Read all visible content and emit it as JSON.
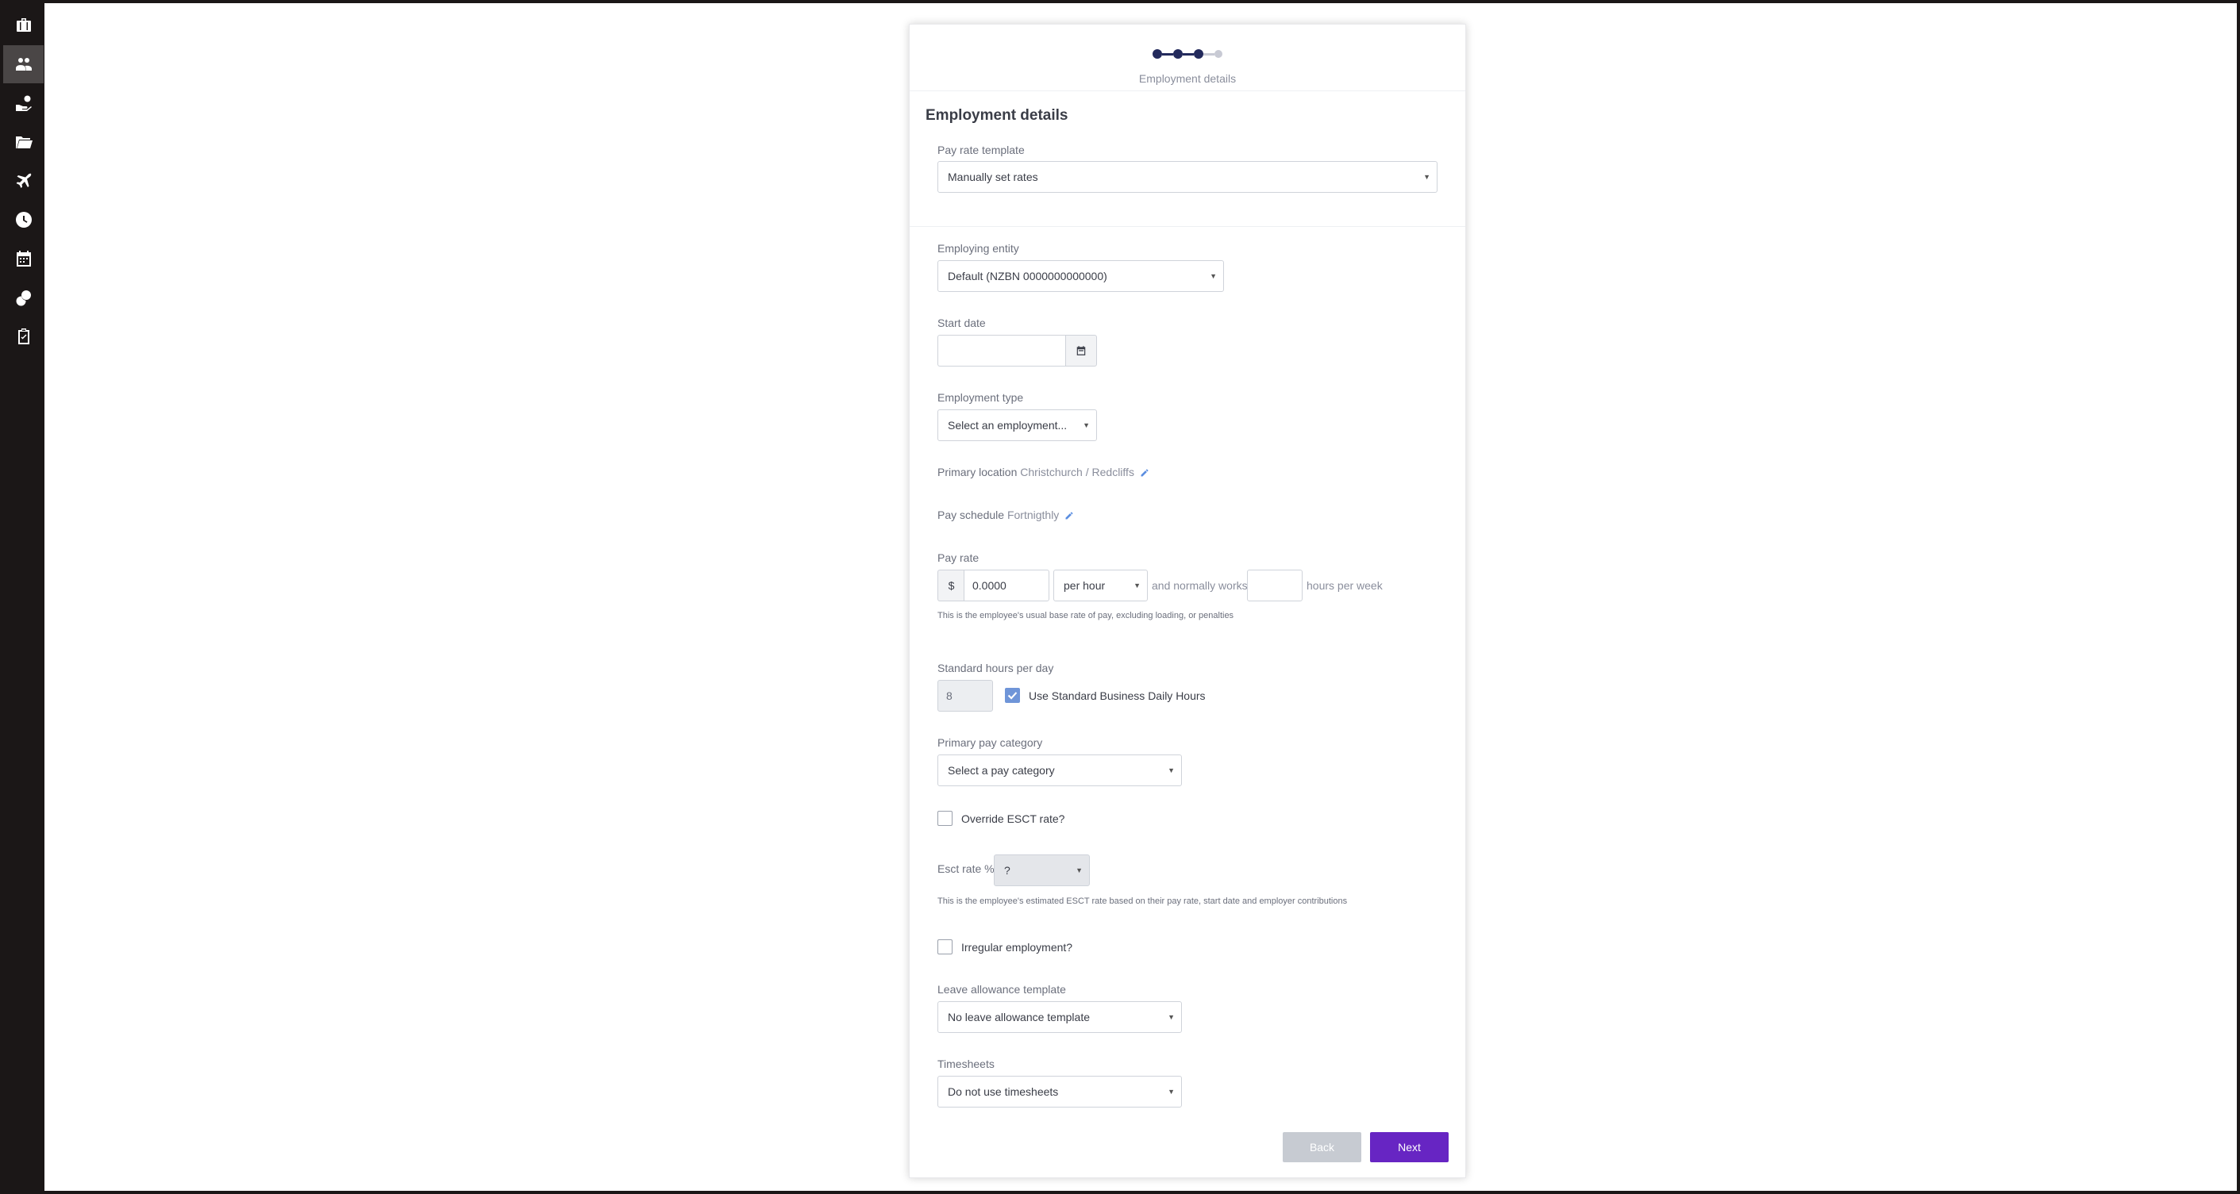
{
  "sidebar": {
    "items": [
      {
        "icon": "briefcase-icon"
      },
      {
        "icon": "people-icon",
        "active": true
      },
      {
        "icon": "hand-coin-icon"
      },
      {
        "icon": "folder-icon"
      },
      {
        "icon": "airplane-icon"
      },
      {
        "icon": "clock-icon"
      },
      {
        "icon": "calendar-icon"
      },
      {
        "icon": "coins-icon"
      },
      {
        "icon": "clipboard-icon"
      }
    ]
  },
  "stepper": {
    "caption": "Employment details",
    "steps_total": 4,
    "steps_completed": 3
  },
  "section_title": "Employment details",
  "pay_rate_template": {
    "label": "Pay rate template",
    "value": "Manually set rates"
  },
  "employing_entity": {
    "label": "Employing entity",
    "value": "Default (NZBN 0000000000000)"
  },
  "start_date": {
    "label": "Start date",
    "value": ""
  },
  "employment_type": {
    "label": "Employment type",
    "value": "Select an employment..."
  },
  "primary_location": {
    "label": "Primary location",
    "value": "Christchurch / Redcliffs"
  },
  "pay_schedule": {
    "label": "Pay schedule",
    "value": "Fortnigthly"
  },
  "pay_rate": {
    "label": "Pay rate",
    "currency": "$",
    "amount": "0.0000",
    "unit": "per hour",
    "mid_text": "and normally works",
    "hours_value": "",
    "end_text": "hours per week",
    "help": "This is the employee's usual base rate of pay, excluding loading, or penalties"
  },
  "standard_hours": {
    "label": "Standard hours per day",
    "value": "8",
    "checkbox_label": "Use Standard Business Daily Hours",
    "checked": true
  },
  "primary_pay_category": {
    "label": "Primary pay category",
    "value": "Select a pay category"
  },
  "override_esct": {
    "label": "Override ESCT rate?",
    "checked": false
  },
  "esct_rate": {
    "label": "Esct rate %",
    "value": "?",
    "help": "This is the employee's estimated ESCT rate based on their pay rate, start date and employer contributions"
  },
  "irregular_employment": {
    "label": "Irregular employment?",
    "checked": false
  },
  "leave_allowance_template": {
    "label": "Leave allowance template",
    "value": "No leave allowance template"
  },
  "timesheets": {
    "label": "Timesheets",
    "value": "Do not use timesheets"
  },
  "buttons": {
    "back": "Back",
    "next": "Next"
  },
  "colors": {
    "sidebar_bg": "#1b1717",
    "stepper_active": "#232a5c",
    "next_button": "#6725c3",
    "back_button_disabled": "#c7cbd2",
    "checkbox_checked": "#6f95d8",
    "edit_pencil": "#5b8ee0"
  }
}
